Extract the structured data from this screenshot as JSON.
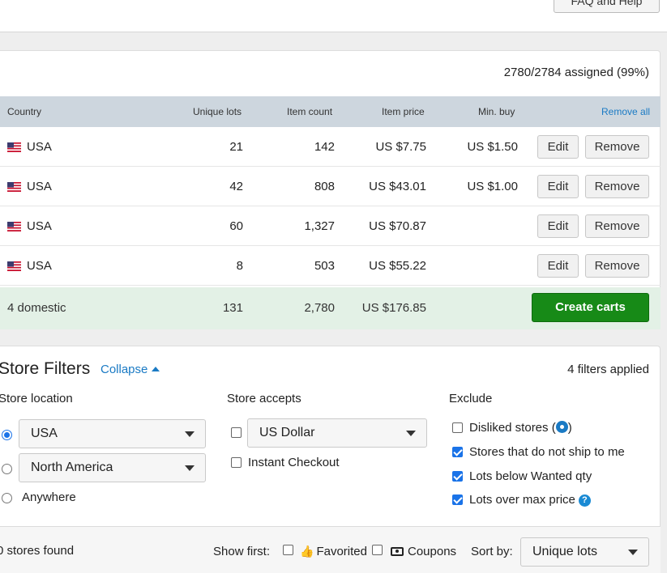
{
  "header": {
    "faq_label": "FAQ and Help"
  },
  "summary": {
    "assigned": "2780/2784 assigned (99%)"
  },
  "table": {
    "headers": {
      "country": "Country",
      "unique_lots": "Unique lots",
      "item_count": "Item count",
      "item_price": "Item price",
      "min_buy": "Min. buy",
      "remove_all": "Remove all"
    },
    "rows": [
      {
        "country": "USA",
        "unique_lots": "21",
        "item_count": "142",
        "item_price": "US $7.75",
        "min_buy": "US $1.50"
      },
      {
        "country": "USA",
        "unique_lots": "42",
        "item_count": "808",
        "item_price": "US $43.01",
        "min_buy": "US $1.00"
      },
      {
        "country": "USA",
        "unique_lots": "60",
        "item_count": "1,327",
        "item_price": "US $70.87",
        "min_buy": ""
      },
      {
        "country": "USA",
        "unique_lots": "8",
        "item_count": "503",
        "item_price": "US $55.22",
        "min_buy": ""
      }
    ],
    "edit_label": "Edit",
    "remove_label": "Remove",
    "total": {
      "label": "4 domestic",
      "unique_lots": "131",
      "item_count": "2,780",
      "item_price": "US $176.85"
    },
    "create_carts_label": "Create carts"
  },
  "filters": {
    "title": "Store Filters",
    "collapse_label": "Collapse",
    "applied": "4 filters applied",
    "store_location": {
      "heading": "Store location",
      "select1": "USA",
      "select2": "North America",
      "anywhere": "Anywhere"
    },
    "store_accepts": {
      "heading": "Store accepts",
      "currency": "US Dollar",
      "instant_checkout": "Instant Checkout"
    },
    "exclude": {
      "heading": "Exclude",
      "disliked_prefix": "Disliked stores (",
      "disliked_suffix": ")",
      "no_ship": "Stores that do not ship to me",
      "below_wanted": "Lots below Wanted qty",
      "over_max": "Lots over max price",
      "help_glyph": "?"
    }
  },
  "bottom": {
    "stores_found": "0 stores found",
    "show_first": "Show first:",
    "favorited": "Favorited",
    "coupons": "Coupons",
    "sort_by": "Sort by:",
    "sort_value": "Unique lots"
  },
  "colors": {
    "accent": "#1a7ac4",
    "create_green": "#178a17",
    "header_bg": "#cdd6de",
    "total_bg": "#e3f1e6"
  },
  "icons": {
    "flag": "us-flag-icon",
    "gear": "gear-icon",
    "help": "help-icon",
    "thumb": "thumbs-up-icon",
    "coupon": "coupon-icon"
  }
}
